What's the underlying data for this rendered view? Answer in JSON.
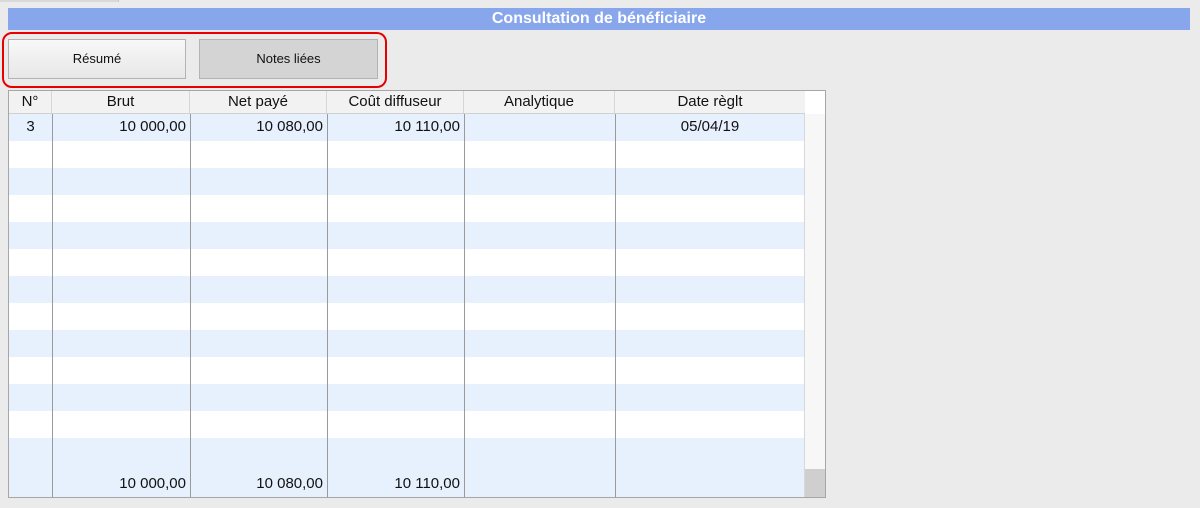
{
  "window": {
    "title": "Consultation de bénéficiaire"
  },
  "buttons": {
    "resume": "Résumé",
    "notes": "Notes liées"
  },
  "table": {
    "columns": [
      "N°",
      "Brut",
      "Net payé",
      "Coût diffuseur",
      "Analytique",
      "Date règlt"
    ],
    "rows": [
      {
        "num": "3",
        "brut": "10 000,00",
        "net": "10 080,00",
        "cout": "10 110,00",
        "analytique": "",
        "date": "05/04/19"
      }
    ],
    "totals": {
      "brut": "10 000,00",
      "net": "10 080,00",
      "cout": "10 110,00"
    }
  },
  "colors": {
    "title_bar": "#87a6ec",
    "stripe": "#e6f1fd",
    "highlight": "#e60000"
  }
}
